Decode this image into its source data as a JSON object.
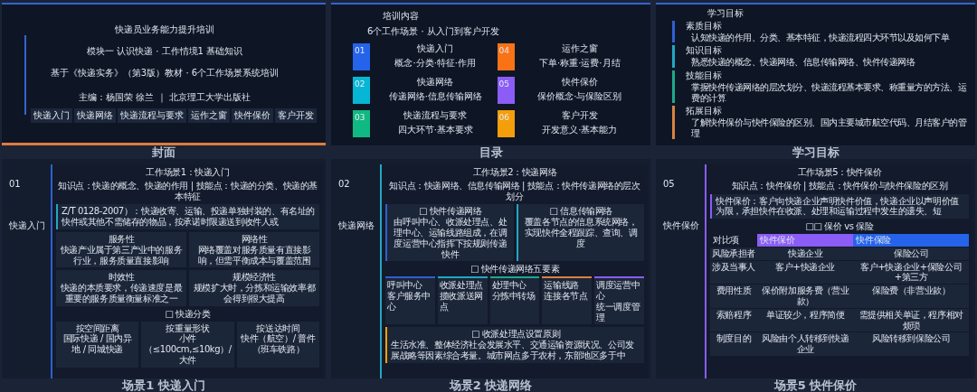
{
  "slides": [
    {
      "kind": "cover",
      "caption": "封面",
      "title": "快递员业务能力提升培训",
      "lines": [
        "模块一 认识快递 · 工作情境1 基础知识",
        "基于《快递实务》（第3版）教材 · 6个工作场景系统培训"
      ],
      "editor": "主编：杨国荣 徐兰 ｜ 北京理工大学出版社",
      "tags": [
        "快递入门",
        "快递网络",
        "快递流程与要求",
        "运作之窗",
        "快件保价",
        "客户开发"
      ]
    },
    {
      "kind": "contents",
      "caption": "目录",
      "heading": "培训内容",
      "subtitle": "6个工作场景 · 从入门到客户开发",
      "items": [
        {
          "number": "01",
          "title": "快递入门",
          "subtitle": "概念·分类·特征·作用",
          "color": "#2563eb"
        },
        {
          "number": "04",
          "title": "运作之窗",
          "subtitle": "下单·称重·运费·月结",
          "color": "#f97316"
        },
        {
          "number": "02",
          "title": "快递网络",
          "subtitle": "传递网络·信息传输网络",
          "color": "#06b6d4"
        },
        {
          "number": "05",
          "title": "快件保价",
          "subtitle": "保价概念·与保险区别",
          "color": "#8b5cf6"
        },
        {
          "number": "03",
          "title": "快递流程与要求",
          "subtitle": "四大环节·基本要求",
          "color": "#10b981"
        },
        {
          "number": "06",
          "title": "客户开发",
          "subtitle": "开发意义·基本能力",
          "color": "#f59e0b"
        }
      ]
    },
    {
      "kind": "goals",
      "caption": "学习目标",
      "heading": "学习目标",
      "goals": [
        {
          "label": "素质目标",
          "text": "认知快递的作用、分类、基本特征，快递流程四大环节以及如何下单",
          "color": "#2f5fd0"
        },
        {
          "label": "知识目标",
          "text": "熟悉快递的概念、快递网络、信息传输网络、快件传递网络",
          "color": "#22a6c4"
        },
        {
          "label": "技能目标",
          "text": "掌握快件传递网络的层次划分、快递流程基本要求、称重量方的方法、运费的计算",
          "color": "#1fa88a"
        },
        {
          "label": "拓展目标",
          "text": "了解快件保价与快件保险的区别、国内主要城市航空代码、月结客户的管理",
          "color": "#d9823f"
        }
      ]
    },
    {
      "kind": "scene",
      "caption": "场景1 快递入门",
      "number": "01",
      "label": "快递入门",
      "color": "#2f5fd0",
      "title": "工作场景1：快递入门",
      "points": "知识点：快递的概念、快递的作用 | 技能点：快递的分类、快递的基本特征",
      "blocks": [
        {
          "kind": "note",
          "text": "Z/T 0128-2007）：快递收寄、运输、投递单独封装的、有名址的快件或其他不需储存的物品，按承诺时限递送到收件人或",
          "color": "#22a6c4"
        },
        {
          "kind": "cards",
          "cards": [
            {
              "title": "服务性",
              "text": "快递产业属于第三产业中的服务行业，服务质量直接影响"
            },
            {
              "title": "网络性",
              "text": "网络覆盖对服务质量有直接影响，但需平衡成本与覆盖范围"
            },
            {
              "title": "时效性",
              "text": "快递的本质要求，传递速度是最重要的服务质量衡量标准之一"
            },
            {
              "title": "规模经济性",
              "text": "规模扩大时，分拣和运输效率都会得到很大提高"
            }
          ]
        },
        {
          "kind": "cards",
          "heading": "□ 快递分类",
          "cards": [
            {
              "title": "按空间距离",
              "text": "国际快递 / 国内异地 / 同城快递"
            },
            {
              "title": "按重量形状",
              "text": "小件（≤100cm,≤10kg）/ 大件"
            },
            {
              "title": "按送达时间",
              "text": "快件（航空）/ 普件（班车铁路）"
            }
          ]
        }
      ]
    },
    {
      "kind": "scene",
      "caption": "场景2 快递网络",
      "number": "02",
      "label": "快递网络",
      "color": "#22a6c4",
      "title": "工作场景2：快递网络",
      "points": "知识点：快递网络、信息传输网络 | 技能点：快件传递网络的层次划分",
      "blocks": [
        {
          "kind": "cards",
          "cards": [
            {
              "title": "□ 快件传递网络",
              "text": "由呼叫中心、收派处理点、处理中心、运输线路组成，在调度运营中心指挥下按规则传递快件",
              "color": "#2f5fd0"
            },
            {
              "title": "□ 信息传输网络",
              "text": "覆盖各节点的信息系统网络，实现快件全程跟踪、查询、调度",
              "color": "#22a6c4"
            }
          ]
        },
        {
          "kind": "elements",
          "heading": "□ 快件传递网络五要素",
          "cards": [
            {
              "title": "呼叫中心",
              "text": "客户服务中心",
              "color": "#2f5fd0"
            },
            {
              "title": "收派处理点",
              "text": "揽收派送网点",
              "color": "#22a6c4"
            },
            {
              "title": "处理中心",
              "text": "分拣中转场",
              "color": "#1fa88a"
            },
            {
              "title": "运输线路",
              "text": "连接各节点",
              "color": "#d9823f"
            },
            {
              "title": "调度运营中心",
              "text": "统一调度管理",
              "color": "#8b5cf6"
            }
          ]
        },
        {
          "kind": "note",
          "heading": "□ 收派处理点设置原则",
          "text": "生活水准、整体经济社会发展水平、交通运输资源状况、公司发展战略等因素综合考量。城市网点多于农村，东部地区多于中",
          "color": "#f59e0b"
        }
      ]
    },
    {
      "kind": "scene",
      "caption": "场景5 快件保价",
      "number": "05",
      "label": "快件保价",
      "color": "#8b5cf6",
      "title": "工作场景5：快件保价",
      "points": "知识点：快件保价 | 技能点：快件保价与快件保险的区别",
      "blocks": [
        {
          "kind": "note",
          "text": "快件保价：客户向快递企业声明快件价值，快递企业以声明价值为限，承担快件在收派、处理和运输过程中发生的遗失、短",
          "color": "#8b5cf6"
        },
        {
          "kind": "table",
          "heading": "□□ 保价 vs 保险",
          "columns": [
            {
              "label": "对比项"
            },
            {
              "label": "快件保价",
              "color": "#8b5cf6"
            },
            {
              "label": "快件保险",
              "color": "#2563eb"
            }
          ],
          "rows": [
            [
              "风险承担者",
              "快递企业",
              "保险公司"
            ],
            [
              "涉及当事人",
              "客户+快递企业",
              "客户+快递企业+保险公司+第三方"
            ],
            [
              "费用性质",
              "保价附加服务费（营业款）",
              "保险费（非营业款）"
            ],
            [
              "索赔程序",
              "单证较少，程序简便",
              "需提供相关单证，程序相对烦琐"
            ],
            [
              "制度目的",
              "风险由个人转移到快递企业",
              "风险转移到保险公司"
            ]
          ]
        }
      ]
    }
  ]
}
